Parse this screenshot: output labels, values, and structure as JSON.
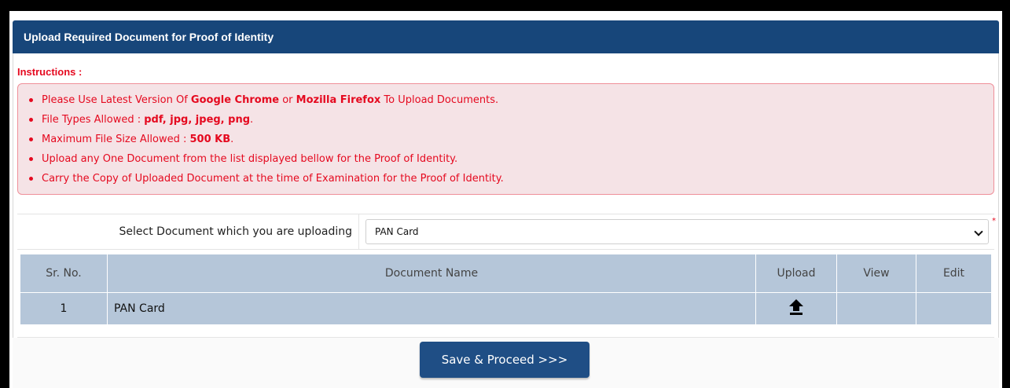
{
  "header": {
    "title": "Upload Required Document for Proof of Identity"
  },
  "instructions": {
    "title": "Instructions :",
    "items": {
      "i1": {
        "a": "Please Use Latest Version Of ",
        "b": "Google Chrome",
        "c": " or ",
        "d": "Mozilla Firefox",
        "e": " To Upload Documents."
      },
      "i2": {
        "a": "File Types Allowed : ",
        "b": "pdf, jpg, jpeg, png",
        "c": "."
      },
      "i3": {
        "a": "Maximum File Size Allowed : ",
        "b": "500 KB",
        "c": "."
      },
      "i4": "Upload any One Document from the list displayed bellow for the Proof of Identity.",
      "i5": "Carry the Copy of Uploaded Document at the time of Examination for the Proof of Identity."
    }
  },
  "select": {
    "label": "Select Document which you are uploading",
    "value": "PAN Card",
    "required_mark": "*"
  },
  "table": {
    "headers": {
      "sr": "Sr. No.",
      "name": "Document Name",
      "upload": "Upload",
      "view": "View",
      "edit": "Edit"
    },
    "rows": [
      {
        "sr": "1",
        "name": "PAN Card",
        "upload_icon": "upload-arrow-icon"
      }
    ]
  },
  "footer": {
    "save_label": "Save & Proceed >>>"
  },
  "colors": {
    "header_bg": "#17467a",
    "accent_red": "#e5091f",
    "table_bg": "#b5c6d9",
    "button_bg": "#1f4e85"
  }
}
